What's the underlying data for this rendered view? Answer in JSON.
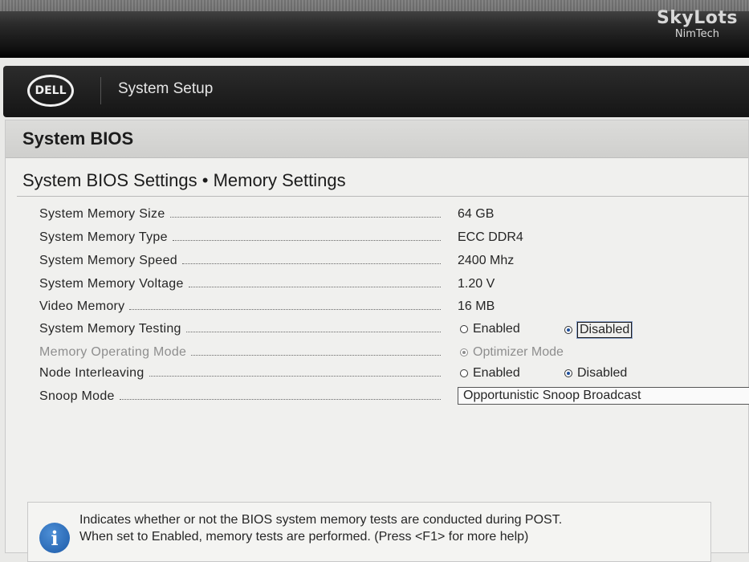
{
  "watermark": {
    "title": "SkyLots",
    "subtitle": "NimTech"
  },
  "header": {
    "logo_text": "DELL",
    "title": "System Setup"
  },
  "panel": {
    "title": "System BIOS",
    "subtitle": "System BIOS Settings • Memory Settings"
  },
  "settings": [
    {
      "label": "System Memory Size",
      "value": "64 GB"
    },
    {
      "label": "System Memory Type",
      "value": "ECC DDR4"
    },
    {
      "label": "System Memory Speed",
      "value": "2400 Mhz"
    },
    {
      "label": "System Memory Voltage",
      "value": "1.20 V"
    },
    {
      "label": "Video Memory",
      "value": "16 MB"
    },
    {
      "label": "System Memory Testing",
      "options": [
        "Enabled",
        "Disabled"
      ],
      "selected": "Disabled"
    },
    {
      "label": "Memory Operating Mode",
      "options": [
        "Optimizer Mode"
      ],
      "selected": "Optimizer Mode"
    },
    {
      "label": "Node Interleaving",
      "options": [
        "Enabled",
        "Disabled"
      ],
      "selected": "Disabled"
    },
    {
      "label": "Snoop Mode",
      "value": "Opportunistic Snoop Broadcast"
    }
  ],
  "help": {
    "line1": "Indicates whether or not the BIOS system memory tests are conducted during POST.",
    "line2": "When set to Enabled, memory tests are performed. (Press <F1> for more help)"
  }
}
